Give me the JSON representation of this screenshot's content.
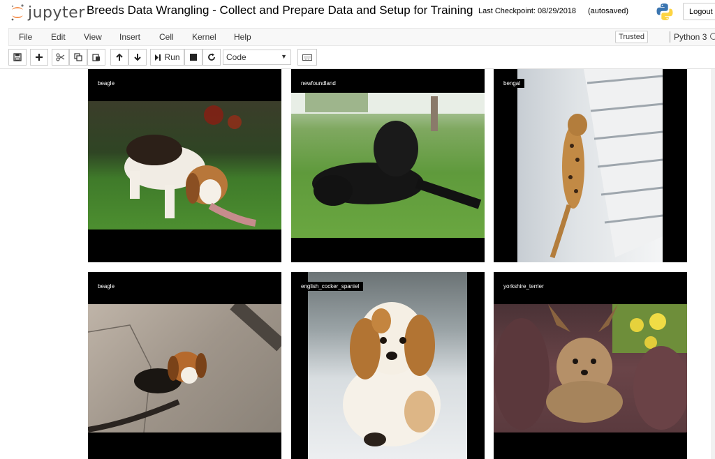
{
  "header": {
    "logo_text": "jupyter",
    "notebook_title": "Breeds Data Wrangling - Collect and Prepare Data and Setup for Training",
    "checkpoint": "Last Checkpoint: 08/29/2018",
    "autosave_status": "(autosaved)",
    "logout_label": "Logout"
  },
  "menubar": {
    "items": [
      "File",
      "Edit",
      "View",
      "Insert",
      "Cell",
      "Kernel",
      "Help"
    ],
    "trusted_label": "Trusted",
    "kernel_name": "Python 3"
  },
  "toolbar": {
    "buttons": [
      "save-icon",
      "plus-icon",
      "scissors-icon",
      "copy-icon",
      "paste-icon",
      "arrow-up-icon",
      "arrow-down-icon",
      "run-icon",
      "stop-icon",
      "restart-icon",
      "keyboard-icon"
    ],
    "run_label": "Run",
    "cell_type_value": "Code"
  },
  "output_grid": {
    "tiles": [
      {
        "label": "beagle"
      },
      {
        "label": "newfoundland"
      },
      {
        "label": "bengal"
      },
      {
        "label": "beagle"
      },
      {
        "label": "english_cocker_spaniel"
      },
      {
        "label": "yorkshire_terrier"
      }
    ]
  },
  "colors": {
    "jupyter_orange": "#f37726",
    "menubar_bg": "#f8f8f8",
    "tile_bg": "#000000"
  }
}
